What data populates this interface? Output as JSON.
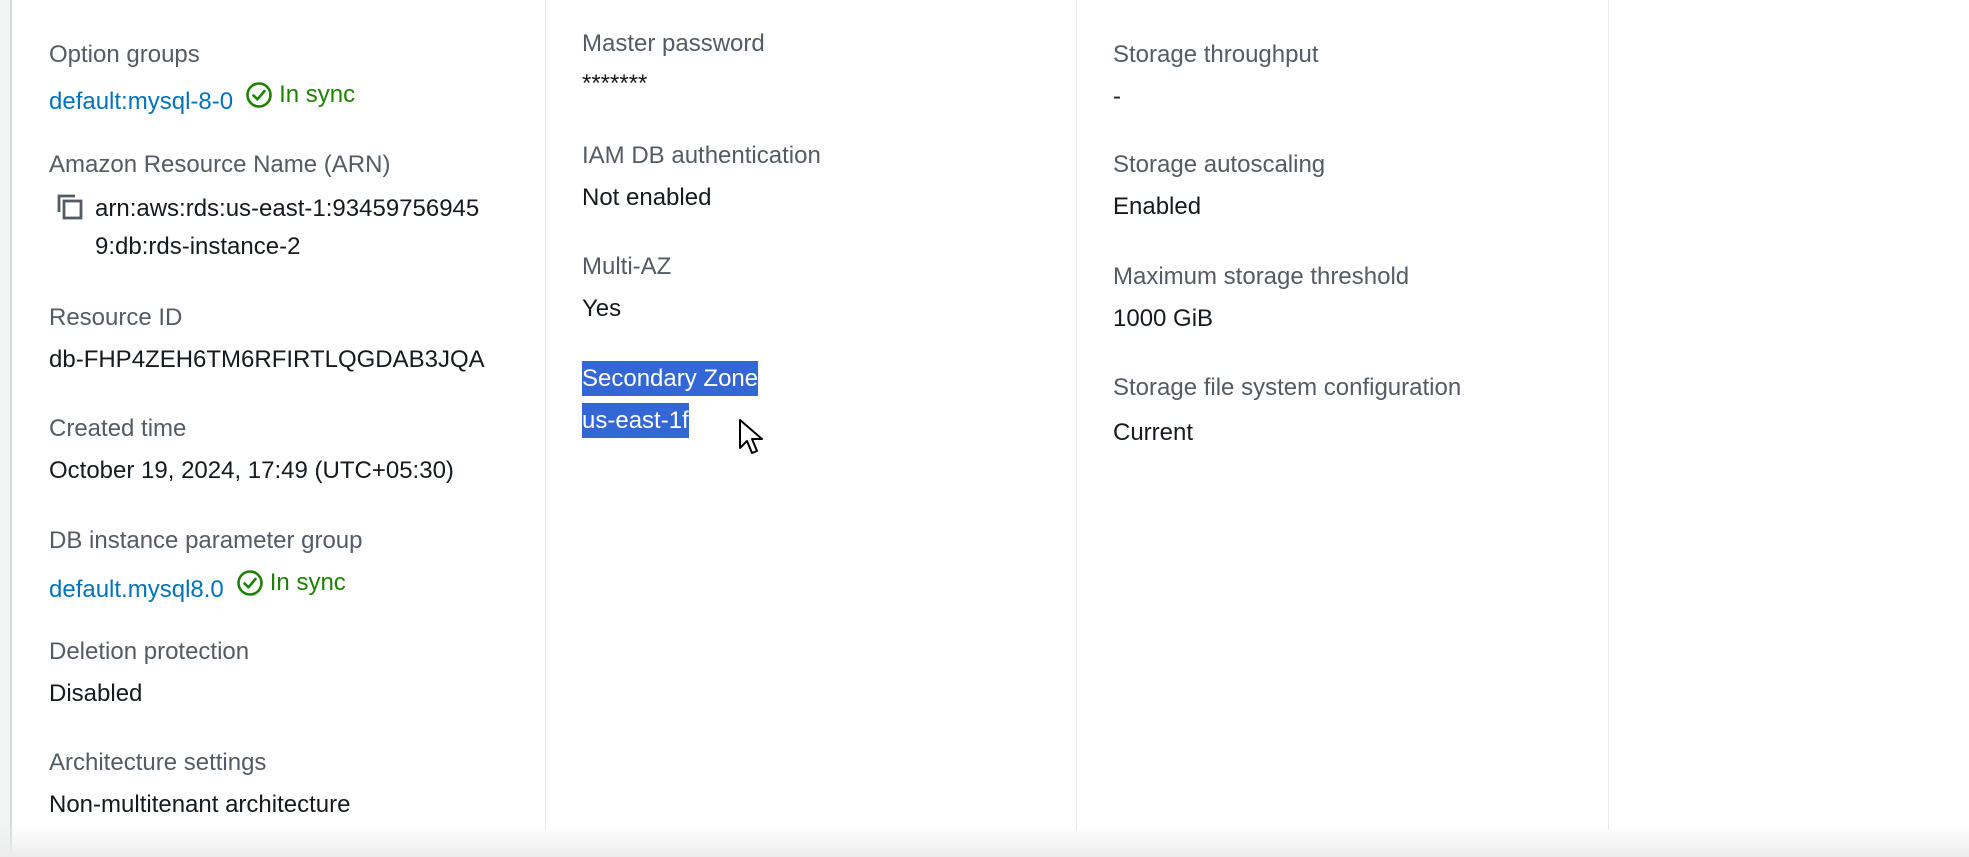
{
  "column1": {
    "option_groups": {
      "label": "Option groups",
      "link": "default:mysql-8-0",
      "status": "In sync"
    },
    "arn": {
      "label": "Amazon Resource Name (ARN)",
      "value": "arn:aws:rds:us-east-1:934597569459:db:rds-instance-2"
    },
    "resource_id": {
      "label": "Resource ID",
      "value": "db-FHP4ZEH6TM6RFIRTLQGDAB3JQA"
    },
    "created_time": {
      "label": "Created time",
      "value": "October 19, 2024, 17:49 (UTC+05:30)"
    },
    "param_group": {
      "label": "DB instance parameter group",
      "link": "default.mysql8.0",
      "status": "In sync"
    },
    "deletion_protection": {
      "label": "Deletion protection",
      "value": "Disabled"
    },
    "architecture": {
      "label": "Architecture settings",
      "value": "Non-multitenant architecture"
    }
  },
  "column2": {
    "master_password": {
      "label": "Master password",
      "value": "*******"
    },
    "iam_auth": {
      "label": "IAM DB authentication",
      "value": "Not enabled"
    },
    "multi_az": {
      "label": "Multi-AZ",
      "value": "Yes"
    },
    "secondary_zone": {
      "label": "Secondary Zone",
      "value": "us-east-1f"
    }
  },
  "column3": {
    "storage_throughput": {
      "label": "Storage throughput",
      "value": "-"
    },
    "storage_autoscaling": {
      "label": "Storage autoscaling",
      "value": "Enabled"
    },
    "max_storage": {
      "label": "Maximum storage threshold",
      "value": "1000 GiB"
    },
    "fs_config": {
      "label": "Storage file system configuration",
      "value": "Current"
    }
  },
  "colors": {
    "link": "#0073bb",
    "success": "#1d8102",
    "selection": "#3367d6"
  },
  "icons": {
    "sync": "check-circle-icon",
    "copy": "copy-icon",
    "cursor": "mouse-pointer-icon"
  }
}
